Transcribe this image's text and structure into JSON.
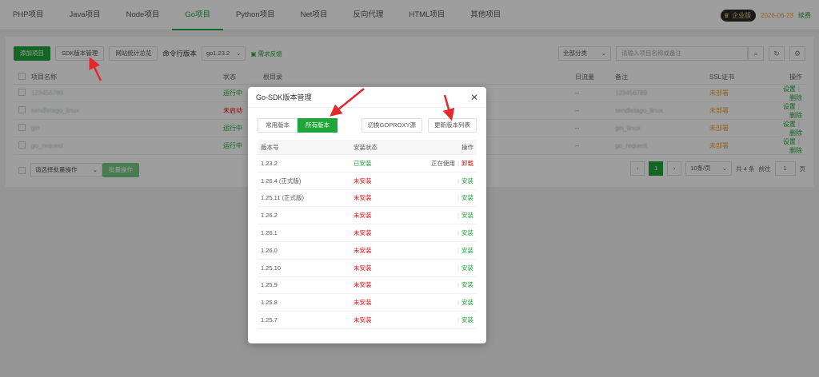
{
  "topnav": {
    "tabs": [
      "PHP项目",
      "Java项目",
      "Node项目",
      "Go项目",
      "Python项目",
      "Net项目",
      "反向代理",
      "HTML项目",
      "其他项目"
    ],
    "active_tab": "Go项目",
    "edition_badge": "企业版",
    "expire_date": "2026-06-23",
    "renew_label": "续费"
  },
  "toolbar": {
    "add_label": "添加项目",
    "sdk_label": "SDK版本管理",
    "stats_label": "网站统计总览",
    "cli_label": "命令行版本",
    "cli_value": "go1.23.2",
    "feedback_label": "需求反馈",
    "category_value": "全部分类",
    "search_placeholder": "请输入项目名称或备注"
  },
  "table": {
    "headers": {
      "name": "项目名称",
      "status": "状态",
      "dir": "根目录",
      "flow": "日流量",
      "note": "备注",
      "ssl": "SSL证书",
      "ops": "操作"
    },
    "rows": [
      {
        "name": "123456789",
        "status": "运行中",
        "flow": "--",
        "note": "123456789",
        "ssl": "未部署",
        "set": "设置",
        "del": "删除"
      },
      {
        "name": "sendletago_linux",
        "status": "未启动",
        "flow": "--",
        "note": "sendletago_linux",
        "ssl": "未部署",
        "set": "设置",
        "del": "删除"
      },
      {
        "name": "gin",
        "status": "运行中",
        "flow": "--",
        "note": "gin_linux",
        "ssl": "未部署",
        "set": "设置",
        "del": "删除"
      },
      {
        "name": "go_request",
        "status": "运行中",
        "flow": "--",
        "note": "go_request",
        "ssl": "未部署",
        "set": "设置",
        "del": "删除"
      }
    ],
    "batch_placeholder": "请选择批量操作",
    "batch_button": "批量操作"
  },
  "pager": {
    "current": "1",
    "page_size": "10条/页",
    "total": "共 4 条",
    "goto_label": "前往",
    "goto_value": "1",
    "page_unit": "页"
  },
  "modal": {
    "title": "Go-SDK版本管理",
    "tab_common": "常用版本",
    "tab_all": "所有版本",
    "switch_proxy": "切换GOPROXY源",
    "update_list": "更新版本列表",
    "headers": {
      "version": "版本号",
      "status": "安装状态",
      "ops": "操作"
    },
    "rows": [
      {
        "version": "1.23.2",
        "status": "已安装",
        "in_use": "正在使用",
        "action": "卸载"
      },
      {
        "version": "1.26.4 (正式版)",
        "status": "未安装",
        "action": "安装"
      },
      {
        "version": "1.25.11 (正式版)",
        "status": "未安装",
        "action": "安装"
      },
      {
        "version": "1.26.2",
        "status": "未安装",
        "action": "安装"
      },
      {
        "version": "1.26.1",
        "status": "未安装",
        "action": "安装"
      },
      {
        "version": "1.26.0",
        "status": "未安装",
        "action": "安装"
      },
      {
        "version": "1.25.10",
        "status": "未安装",
        "action": "安装"
      },
      {
        "version": "1.25.9",
        "status": "未安装",
        "action": "安装"
      },
      {
        "version": "1.25.8",
        "status": "未安装",
        "action": "安装"
      },
      {
        "version": "1.25.7",
        "status": "未安装",
        "action": "安装"
      }
    ]
  },
  "colors": {
    "accent": "#20a53a",
    "danger": "#ef0808",
    "warning": "#e6a23c",
    "arrow": "#e5282b"
  }
}
